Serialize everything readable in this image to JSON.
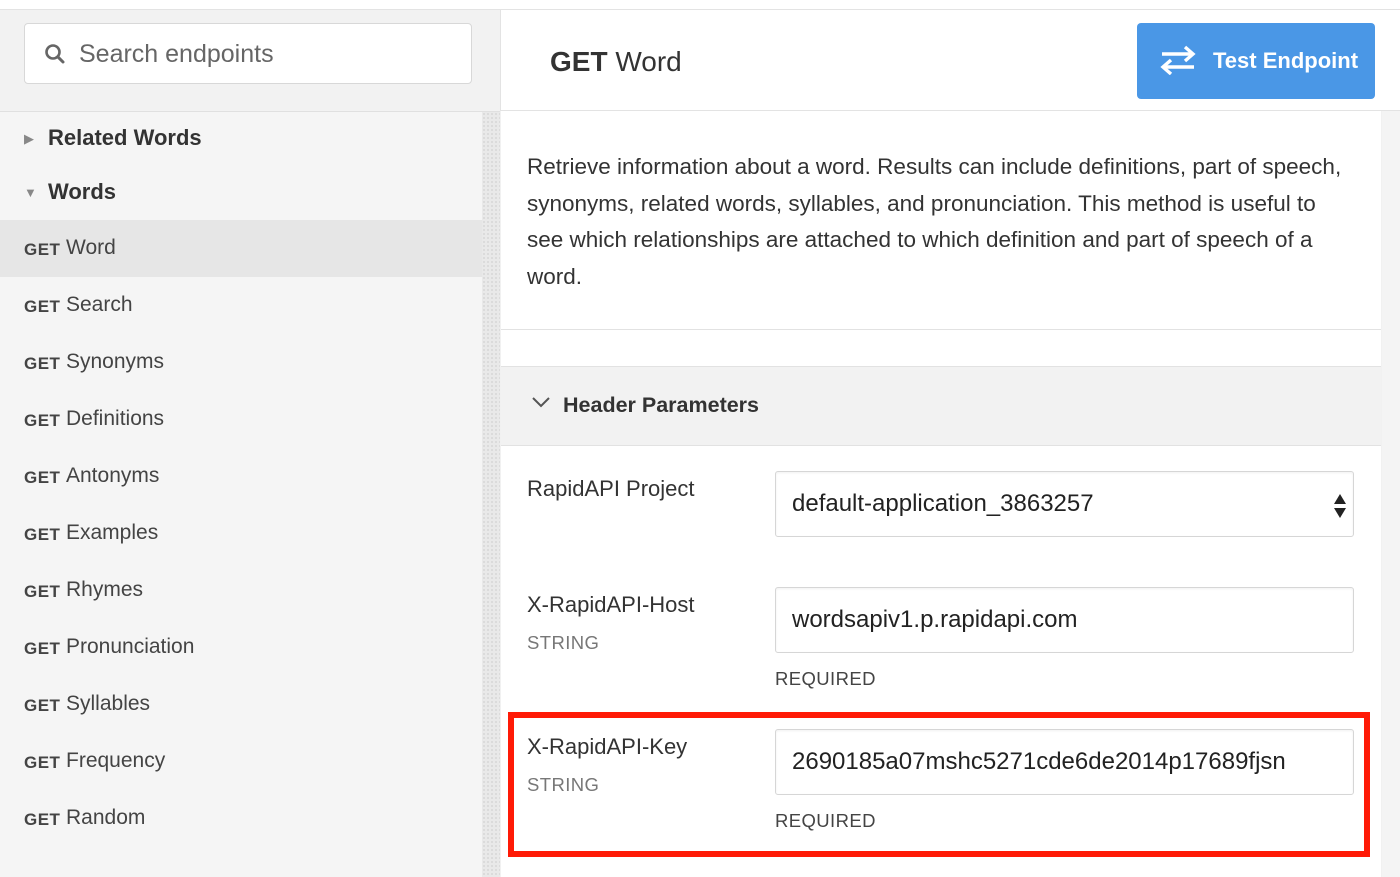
{
  "search": {
    "placeholder": "Search endpoints"
  },
  "sidebar": {
    "groups": [
      {
        "label": "Related Words",
        "expanded": false
      },
      {
        "label": "Words",
        "expanded": true
      }
    ],
    "endpoints": [
      {
        "method": "GET",
        "name": "Word",
        "active": true
      },
      {
        "method": "GET",
        "name": "Search"
      },
      {
        "method": "GET",
        "name": "Synonyms"
      },
      {
        "method": "GET",
        "name": "Definitions"
      },
      {
        "method": "GET",
        "name": "Antonyms"
      },
      {
        "method": "GET",
        "name": "Examples"
      },
      {
        "method": "GET",
        "name": "Rhymes"
      },
      {
        "method": "GET",
        "name": "Pronunciation"
      },
      {
        "method": "GET",
        "name": "Syllables"
      },
      {
        "method": "GET",
        "name": "Frequency"
      },
      {
        "method": "GET",
        "name": "Random"
      }
    ]
  },
  "header": {
    "method": "GET",
    "endpoint": "Word",
    "test_button": "Test Endpoint"
  },
  "description": "Retrieve information about a word. Results can include definitions, part of speech, synonyms, related words, syllables, and pronunciation. This method is useful to see which relationships are attached to which definition and part of speech of a word.",
  "params": {
    "section_title": "Header Parameters",
    "project": {
      "label": "RapidAPI Project",
      "value": "default-application_3863257"
    },
    "host": {
      "label": "X-RapidAPI-Host",
      "type": "STRING",
      "value": "wordsapiv1.p.rapidapi.com",
      "required": "REQUIRED"
    },
    "key": {
      "label": "X-RapidAPI-Key",
      "type": "STRING",
      "value": "2690185a07mshc5271cde6de2014p17689fjsn",
      "required": "REQUIRED"
    }
  },
  "colors": {
    "accent": "#4a97e6",
    "highlight": "#ff1a06"
  },
  "icons": {
    "search": "search-icon",
    "test": "swap-arrows-icon",
    "collapse": "chevron-down-icon",
    "select": "select-arrows-icon"
  }
}
